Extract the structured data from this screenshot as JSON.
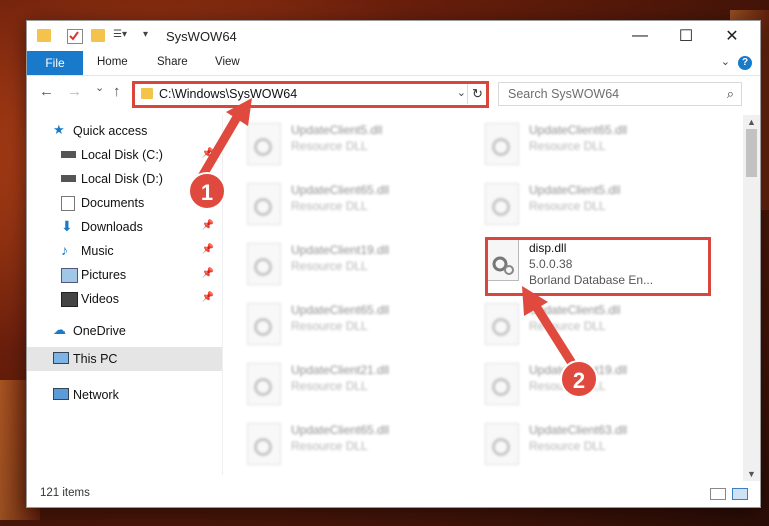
{
  "window": {
    "title": "SysWOW64",
    "controls": {
      "minimize": "—",
      "maximize": "☐",
      "close": "✕"
    }
  },
  "ribbon": {
    "file_tab": "File",
    "tabs": [
      "Home",
      "Share",
      "View"
    ],
    "help": "?"
  },
  "nav": {
    "back": "←",
    "forward": "→",
    "recent": "⌄",
    "up": "↑",
    "address": "C:\\Windows\\SysWOW64",
    "search_placeholder": "Search SysWOW64"
  },
  "sidebar": {
    "items": [
      {
        "label": "Quick access",
        "icon": "star-icon"
      },
      {
        "label": "Local Disk (C:)",
        "icon": "drive-icon",
        "pinned": true
      },
      {
        "label": "Local Disk (D:)",
        "icon": "drive-icon",
        "pinned": false
      },
      {
        "label": "Documents",
        "icon": "documents-icon",
        "pinned": true
      },
      {
        "label": "Downloads",
        "icon": "downloads-icon",
        "pinned": true
      },
      {
        "label": "Music",
        "icon": "music-icon",
        "pinned": true
      },
      {
        "label": "Pictures",
        "icon": "pictures-icon",
        "pinned": true
      },
      {
        "label": "Videos",
        "icon": "videos-icon",
        "pinned": true
      },
      {
        "label": "OneDrive",
        "icon": "cloud-icon"
      },
      {
        "label": "This PC",
        "icon": "pc-icon",
        "selected": true
      },
      {
        "label": "Network",
        "icon": "network-icon"
      }
    ]
  },
  "files": [
    {
      "name": "UpdateClient5.dll",
      "desc": "Resource DLL"
    },
    {
      "name": "UpdateClient65.dll",
      "desc": "Resource DLL"
    },
    {
      "name": "UpdateClient65.dll",
      "desc": "Resource DLL"
    },
    {
      "name": "UpdateClient5.dll",
      "desc": "Resource DLL"
    },
    {
      "name": "UpdateClient19.dll",
      "desc": "Resource DLL"
    },
    {
      "name": "disp.dll",
      "desc": "5.0.0.38",
      "extra": "Borland Database En..."
    },
    {
      "name": "UpdateClient65.dll",
      "desc": "Resource DLL"
    },
    {
      "name": "UpdateClient5.dll",
      "desc": "Resource DLL"
    },
    {
      "name": "UpdateClient21.dll",
      "desc": "Resource DLL"
    },
    {
      "name": "UpdateClient19.dll",
      "desc": "Resource DLL"
    },
    {
      "name": "UpdateClient65.dll",
      "desc": "Resource DLL"
    },
    {
      "name": "UpdateClient63.dll",
      "desc": "Resource DLL"
    }
  ],
  "status": {
    "count": "121 items"
  },
  "annotations": {
    "step1": "1",
    "step2": "2",
    "color": "#d9463c"
  }
}
